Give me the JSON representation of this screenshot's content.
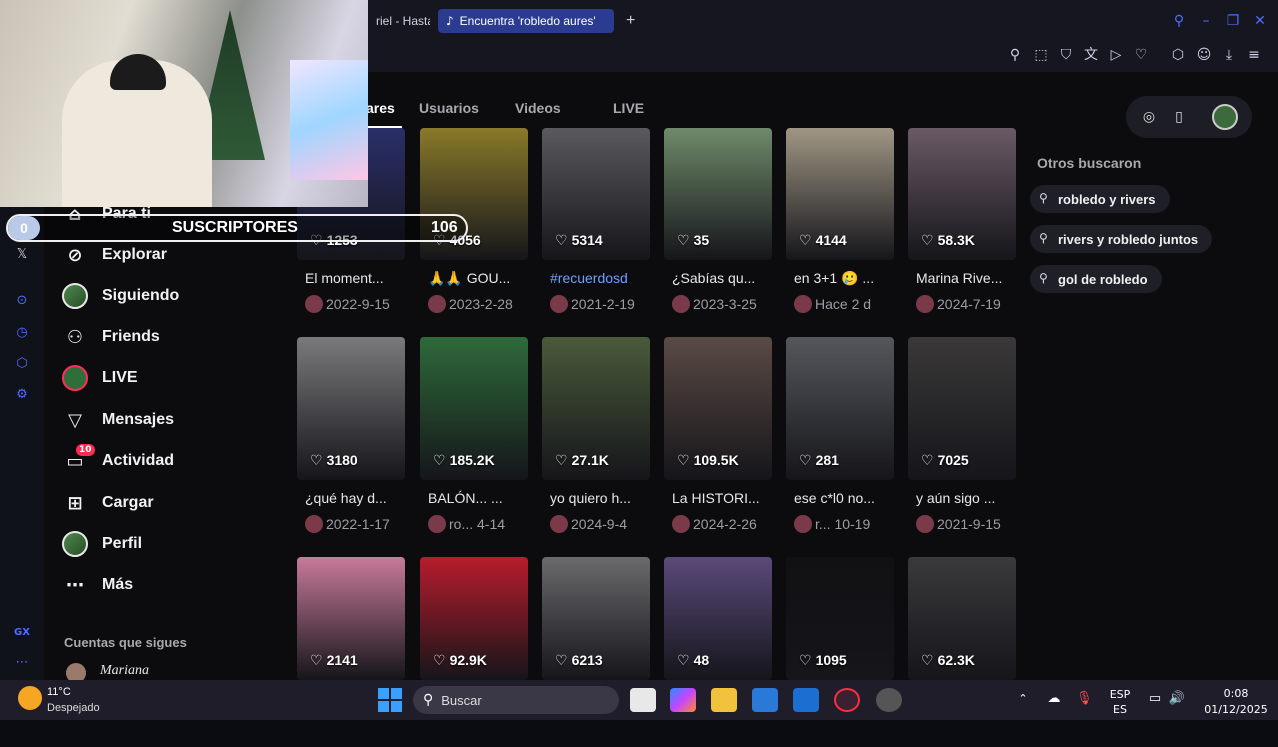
{
  "browser": {
    "tabs": [
      {
        "label": "riel - Hasta"
      },
      {
        "label": "Encuentra 'robledo aures'"
      }
    ],
    "new_tab": "+"
  },
  "cam_overlay": {
    "subs_count": "0",
    "subs_label": "SUSCRIPTORES",
    "subs_goal": "106"
  },
  "sidebar": {
    "items": [
      {
        "label": "Para ti",
        "icon": "home-icon"
      },
      {
        "label": "Explorar",
        "icon": "compass-icon"
      },
      {
        "label": "Siguiendo",
        "icon": "avatar"
      },
      {
        "label": "Friends",
        "icon": "friends-icon"
      },
      {
        "label": "LIVE",
        "icon": "live-avatar"
      },
      {
        "label": "Mensajes",
        "icon": "send-icon"
      },
      {
        "label": "Actividad",
        "icon": "activity-icon",
        "badge": "10"
      },
      {
        "label": "Cargar",
        "icon": "upload-icon"
      },
      {
        "label": "Perfil",
        "icon": "avatar"
      },
      {
        "label": "Más",
        "icon": "more-icon"
      }
    ],
    "following_title": "Cuentas que sigues",
    "following_first": "Mariana"
  },
  "search_tabs": [
    {
      "label": "ares",
      "active": true
    },
    {
      "label": "Usuarios"
    },
    {
      "label": "Videos"
    },
    {
      "label": "LIVE"
    }
  ],
  "videos": [
    {
      "likes": "1253",
      "caption": "El moment...",
      "meta": "2022-9-15",
      "color": "#2a2f6a"
    },
    {
      "likes": "4056",
      "caption": "🙏🙏 GOU...",
      "meta": "2023-2-28",
      "color": "#8a7a2a"
    },
    {
      "likes": "5314",
      "caption": "#recuerdosd",
      "meta": "2021-2-19",
      "color": "#5a5a5e",
      "tag": true
    },
    {
      "likes": "35",
      "caption": "¿Sabías qu...",
      "meta": "2023-3-25",
      "color": "#6f8a6a"
    },
    {
      "likes": "4144",
      "caption": "en 3+1 🥲 ...",
      "meta": "Hace 2 d",
      "color": "#a09684"
    },
    {
      "likes": "58.3K",
      "caption": "Marina Rive...",
      "meta": "2024-7-19",
      "color": "#6a5a66"
    },
    {
      "likes": "3180",
      "caption": "¿qué hay d...",
      "meta": "2022-1-17",
      "color": "#7a7a7c"
    },
    {
      "likes": "185.2K",
      "caption": "BALÓN... ...",
      "meta": "ro... 4-14",
      "color": "#2e6a3a"
    },
    {
      "likes": "27.1K",
      "caption": "yo quiero h...",
      "meta": "2024-9-4",
      "color": "#4a5a3a"
    },
    {
      "likes": "109.5K",
      "caption": "La HISTORI...",
      "meta": "2024-2-26",
      "color": "#5a4a44"
    },
    {
      "likes": "281",
      "caption": "ese c*l0 no...",
      "meta": "r... 10-19",
      "color": "#55575c"
    },
    {
      "likes": "7025",
      "caption": "y aún sigo ...",
      "meta": "2021-9-15",
      "color": "#3a3838"
    },
    {
      "likes": "2141",
      "caption": "",
      "meta": "",
      "color": "#c87a9a"
    },
    {
      "likes": "92.9K",
      "caption": "",
      "meta": "",
      "color": "#b81c2c"
    },
    {
      "likes": "6213",
      "caption": "",
      "meta": "",
      "color": "#6a6a6c"
    },
    {
      "likes": "48",
      "caption": "",
      "meta": "",
      "color": "#5a4a7a"
    },
    {
      "likes": "1095",
      "caption": "",
      "meta": "",
      "color": "#111114"
    },
    {
      "likes": "62.3K",
      "caption": "",
      "meta": "",
      "color": "#3a3a3c"
    }
  ],
  "right_panel": {
    "title": "Otros buscaron",
    "chips": [
      "robledo y rivers",
      "rivers y robledo juntos",
      "gol de robledo"
    ]
  },
  "taskbar": {
    "weather_temp": "11°C",
    "weather_desc": "Despejado",
    "search_placeholder": "Buscar",
    "lang_line1": "ESP",
    "lang_line2": "ES",
    "time": "0:08",
    "date": "01/12/2025"
  }
}
